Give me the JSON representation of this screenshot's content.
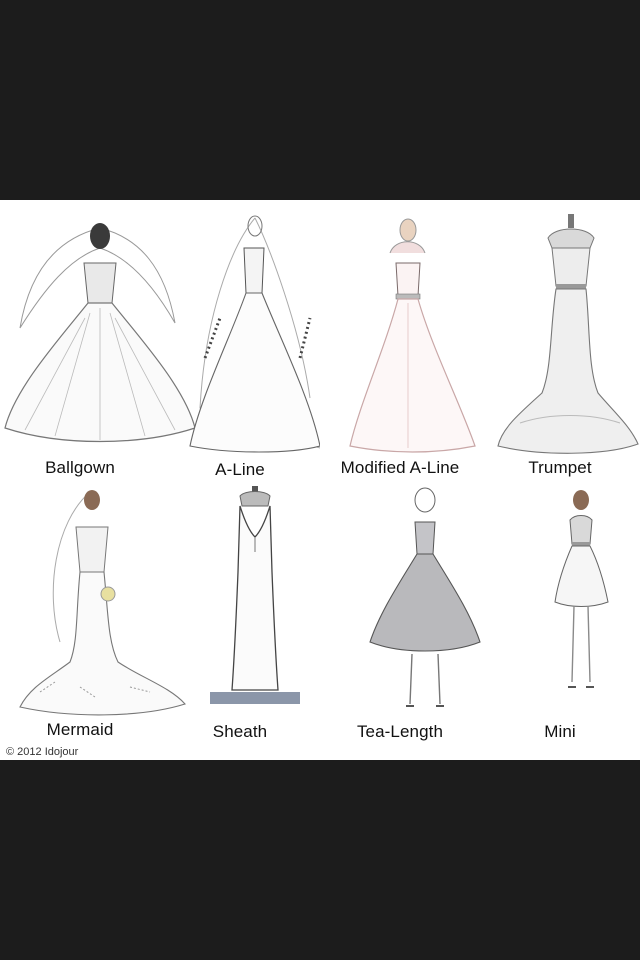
{
  "colors": {
    "background": "#1c1c1c",
    "panel": "#ffffff",
    "sketch": "#6b6b6b",
    "tea_fill": "#b9b9bc",
    "modified_tint": "#e8c9c9"
  },
  "styles": [
    {
      "label": "Ballgown",
      "icon": "ballgown-dress-illustration"
    },
    {
      "label": "A-Line",
      "icon": "a-line-dress-illustration"
    },
    {
      "label": "Modified A-Line",
      "icon": "modified-a-line-dress-illustration"
    },
    {
      "label": "Trumpet",
      "icon": "trumpet-dress-illustration"
    },
    {
      "label": "Mermaid",
      "icon": "mermaid-dress-illustration"
    },
    {
      "label": "Sheath",
      "icon": "sheath-dress-illustration"
    },
    {
      "label": "Tea-Length",
      "icon": "tea-length-dress-illustration"
    },
    {
      "label": "Mini",
      "icon": "mini-dress-illustration"
    }
  ],
  "credit": "© 2012 Idojour"
}
